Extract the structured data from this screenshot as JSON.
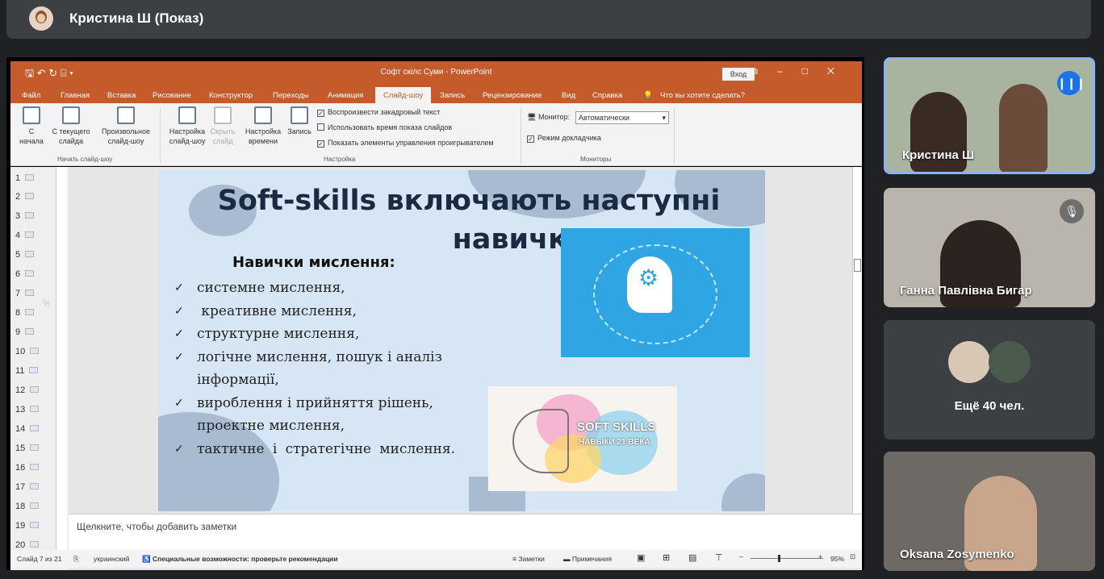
{
  "meet": {
    "presenter_title": "Кристина Ш (Показ)",
    "tiles": [
      {
        "name": "Кристина Ш",
        "mic": "speaking-icon"
      },
      {
        "name": "Ганна Павлівна Бигар",
        "mic": "mic-off-icon"
      },
      {
        "more_label": "Ещё 40 чел."
      },
      {
        "name": "Oksana Zosymenko"
      }
    ]
  },
  "ppt": {
    "window_title": "Софт скілс Суми  -  PowerPoint",
    "signin": "Вход",
    "tabs": [
      "Файл",
      "Главная",
      "Вставка",
      "Рисование",
      "Конструктор",
      "Переходы",
      "Анимация",
      "Слайд-шоу",
      "Запись",
      "Рецензирование",
      "Вид",
      "Справка"
    ],
    "tell_me": "Что вы хотите сделать?",
    "ribbon": {
      "from_start": "С начала",
      "from_current": "С текущего слайда",
      "custom": "Произвольное слайд-шоу",
      "group_start": "Начать слайд-шоу",
      "setup": "Настройка слайд-шоу",
      "hide": "Скрыть слайд",
      "rehearse": "Настройка времени",
      "record": "Запись",
      "chk_narration": "Воспроизвести закадровый текст",
      "chk_timings": "Использовать время показа слайдов",
      "chk_controls": "Показать элементы управления проигрывателем",
      "group_setup": "Настройка",
      "monitor_label": "Монитор:",
      "monitor_value": "Автоматически",
      "presenter_view": "Режим докладчика",
      "group_monitors": "Мониторы"
    },
    "slide_numbers": [
      "1",
      "2",
      "3",
      "4",
      "5",
      "6",
      "7",
      "8",
      "9",
      "10",
      "11",
      "12",
      "13",
      "14",
      "15",
      "16",
      "17",
      "18",
      "19",
      "20"
    ],
    "slide": {
      "title_line1": "Soft-skills включають наступні",
      "title_line2": "навички:",
      "subtitle": "Навички мислення:",
      "bullets": [
        "системне мислення,",
        " креативне мислення,",
        "структурне мислення,",
        "логічне мислення, пошук і аналіз інформації,",
        "вироблення і прийняття рішень, проектне мислення,",
        "тактичне і стратегічне мислення."
      ],
      "image2_title": "SOFT SKILLS",
      "image2_sub": "НАВЫКИ 21 ВЕКА"
    },
    "notes_placeholder": "Щелкните, чтобы добавить заметки",
    "status": {
      "slide_of": "Слайд 7 из 21",
      "language": "украинский",
      "accessibility": "Специальные возможности: проверьте рекомендации",
      "notes": "Заметки",
      "comments": "Примечания",
      "zoom": "95%"
    },
    "accent": "#c55a2a"
  }
}
